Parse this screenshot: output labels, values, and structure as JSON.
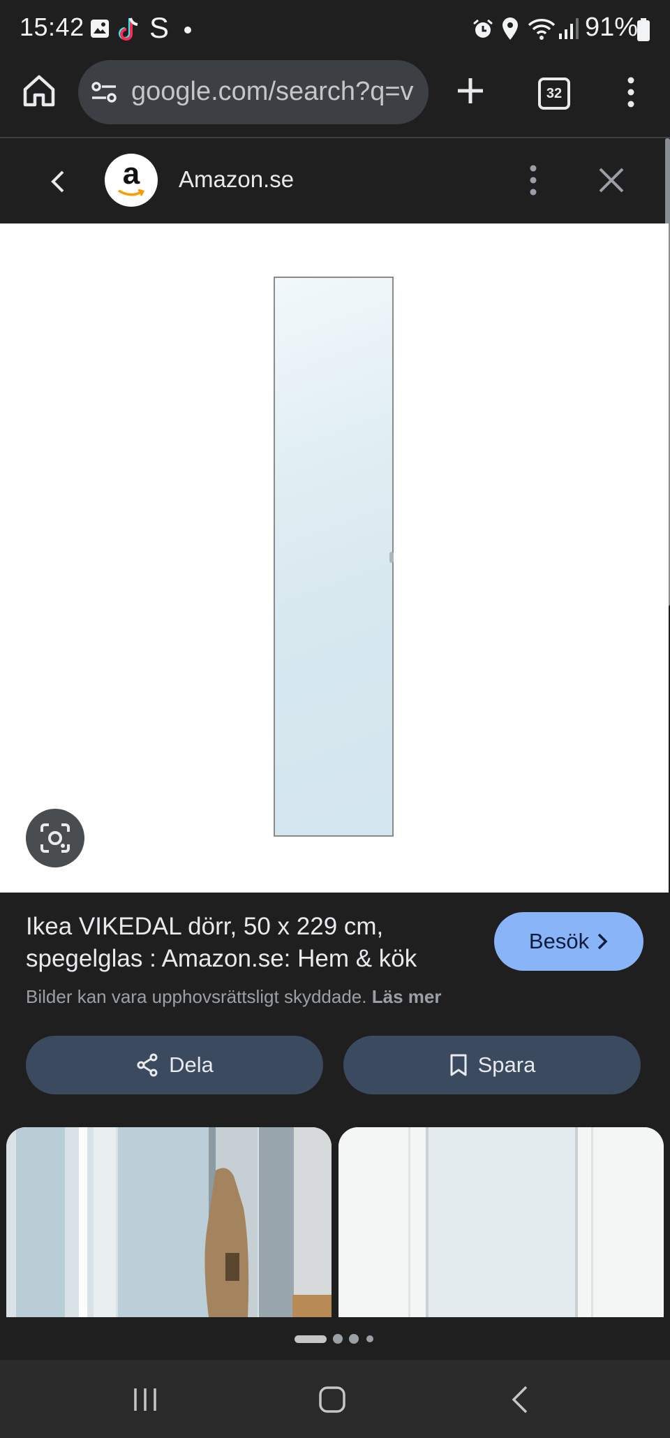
{
  "status_bar": {
    "time": "15:42",
    "battery": "91%",
    "notification_icons": [
      "gallery-icon",
      "tiktok-icon",
      "s-app-icon",
      "dot-icon"
    ],
    "system_icons": [
      "alarm-icon",
      "location-icon",
      "wifi-icon",
      "signal-icon",
      "battery-icon"
    ]
  },
  "browser": {
    "url": "google.com/search?q=v",
    "tab_count": "32"
  },
  "sheet": {
    "site_name": "Amazon.se",
    "logo_letter": "a"
  },
  "result": {
    "title": "Ikea VIKEDAL dörr, 50 x 229 cm, spegelglas : Amazon.se: Hem & kök",
    "visit_label": "Besök",
    "copyright_text": "Bilder kan vara upphovsrättsligt skyddade.",
    "learn_more": "Läs mer",
    "share_label": "Dela",
    "save_label": "Spara"
  },
  "colors": {
    "background": "#1f1f1f",
    "visit_button": "#8ab4f8",
    "action_button": "#3b4a5f",
    "amazon_orange": "#f90"
  }
}
